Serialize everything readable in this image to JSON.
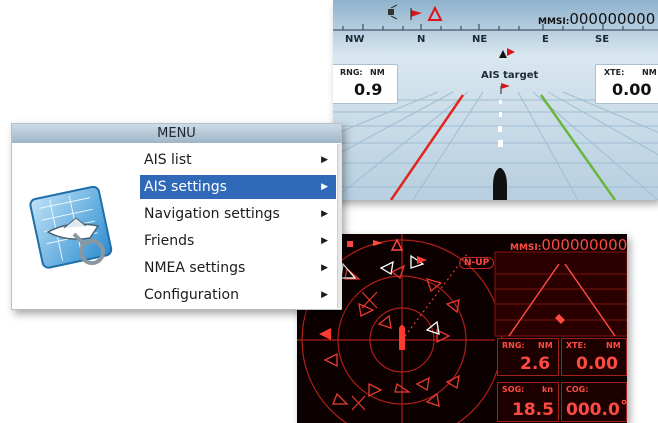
{
  "highway_screen": {
    "mmsi_label": "MMSI:",
    "mmsi_value": "000000000",
    "compass": [
      "NW",
      "N",
      "NE",
      "E",
      "SE"
    ],
    "target_label": "AIS target",
    "rng": {
      "label": "RNG:",
      "unit": "NM",
      "value": "0.9"
    },
    "xte": {
      "label": "XTE:",
      "unit": "NM",
      "value": "0.00"
    },
    "colors": {
      "sky": "#a9c7dc",
      "ground": "#cfe0ec",
      "port_line": "#e2261d",
      "starboard_line": "#6ab63a",
      "flag": "#d8161a"
    }
  },
  "menu": {
    "title": "MENU",
    "selected_index": 1,
    "items": [
      {
        "label": "AIS list",
        "arrow": "▶"
      },
      {
        "label": "AIS settings",
        "arrow": "▶"
      },
      {
        "label": "Navigation settings",
        "arrow": "▶"
      },
      {
        "label": "Friends",
        "arrow": "▶"
      },
      {
        "label": "NMEA settings",
        "arrow": "▶"
      },
      {
        "label": "Configuration",
        "arrow": "▶"
      }
    ],
    "icon": "boat-chart-icon",
    "colors": {
      "selection": "#2f69b8"
    }
  },
  "radar_screen": {
    "mmsi_label": "MMSI:",
    "mmsi_value": "000000000",
    "orientation": "N-UP",
    "rng": {
      "label": "RNG:",
      "unit": "NM",
      "value": "2.6"
    },
    "xte": {
      "label": "XTE:",
      "unit": "NM",
      "value": "0.00"
    },
    "sog": {
      "label": "SOG:",
      "unit": "kn",
      "value": "18.5"
    },
    "cog": {
      "label": "COG:",
      "unit": "",
      "value": "000.0˚"
    },
    "colors": {
      "foreground": "#ff4a42",
      "background": "#0c0000"
    }
  }
}
